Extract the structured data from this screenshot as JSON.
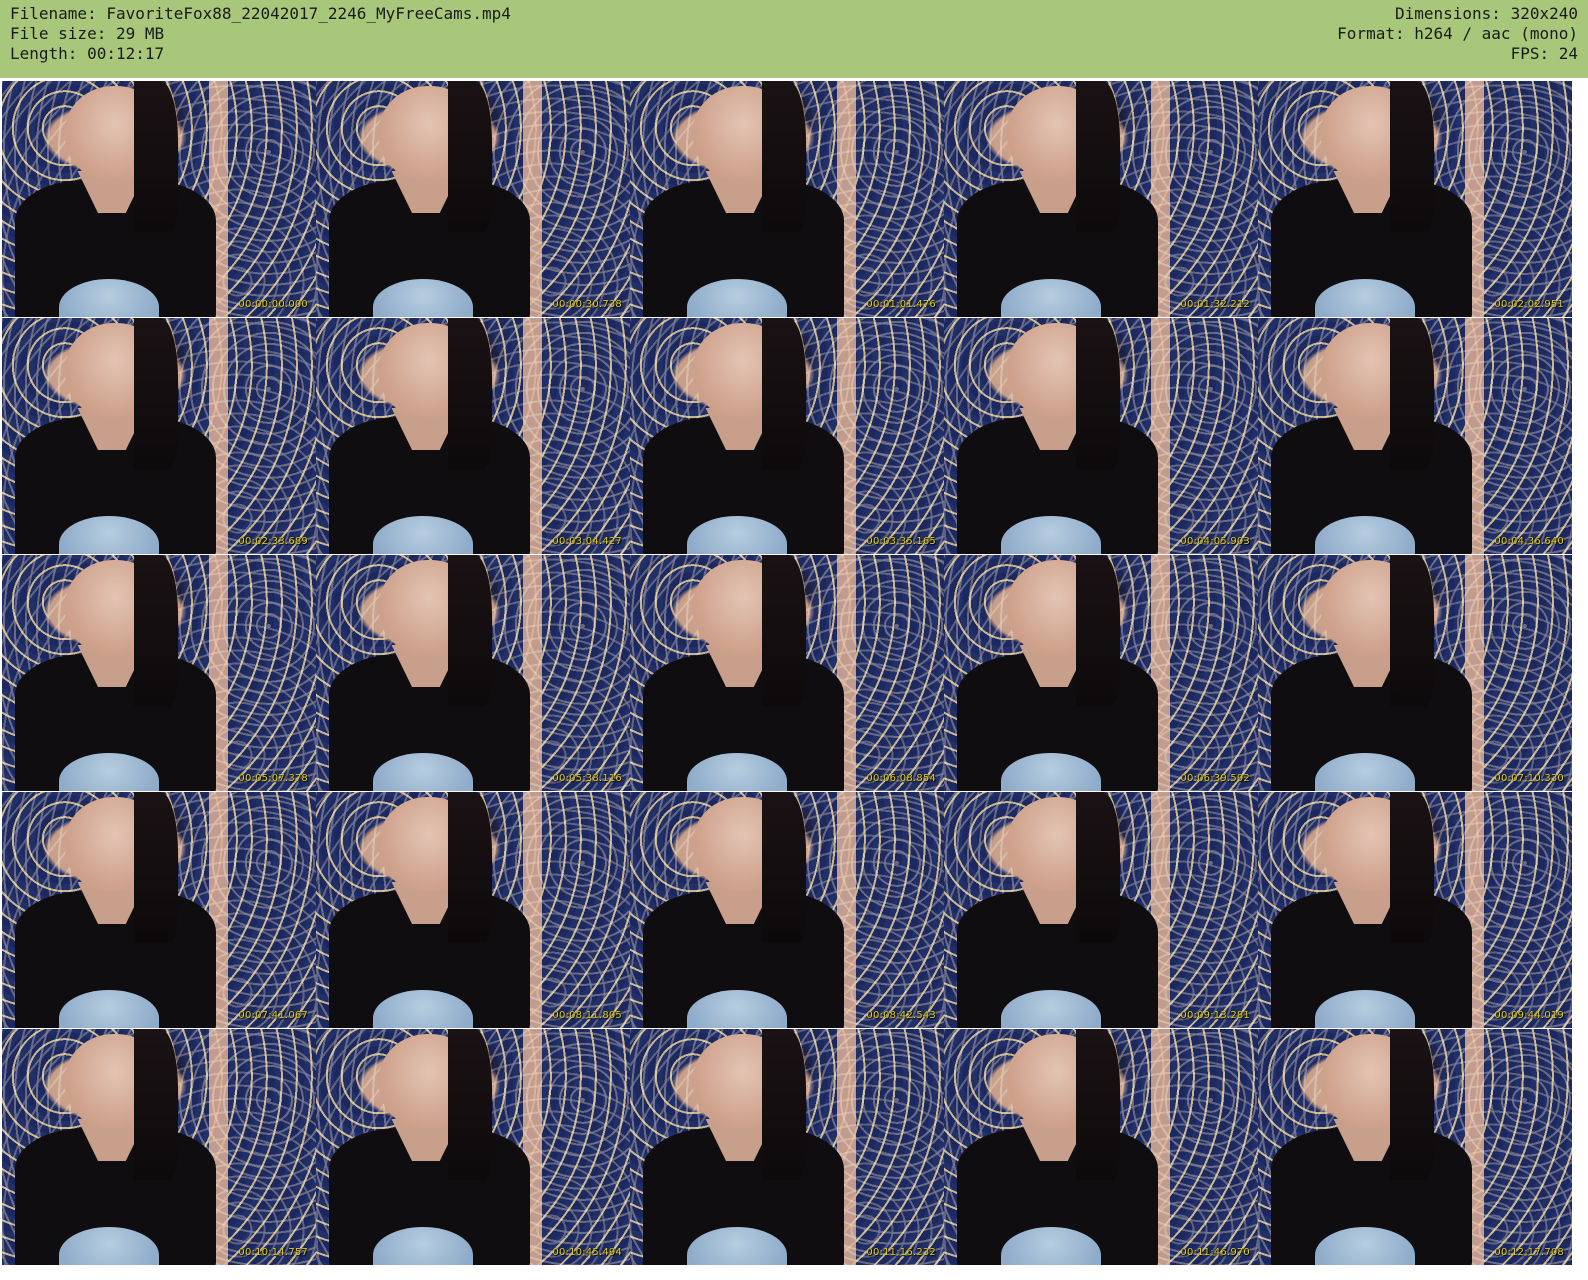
{
  "header": {
    "left": [
      "Filename: FavoriteFox88_22042017_2246_MyFreeCams.mp4",
      "File size: 29 MB",
      "Length: 00:12:17"
    ],
    "right": [
      "Dimensions: 320x240",
      "Format: h264 / aac (mono)",
      "FPS: 24"
    ]
  },
  "thumbnails": [
    {
      "timestamp": "00:00:00.000"
    },
    {
      "timestamp": "00:00:30.738"
    },
    {
      "timestamp": "00:01:01.476"
    },
    {
      "timestamp": "00:01:32.212"
    },
    {
      "timestamp": "00:02:02.951"
    },
    {
      "timestamp": "00:02:33.689"
    },
    {
      "timestamp": "00:03:04.427"
    },
    {
      "timestamp": "00:03:35.165"
    },
    {
      "timestamp": "00:04:05.903"
    },
    {
      "timestamp": "00:04:36.640"
    },
    {
      "timestamp": "00:05:07.378"
    },
    {
      "timestamp": "00:05:38.116"
    },
    {
      "timestamp": "00:06:08.854"
    },
    {
      "timestamp": "00:06:39.592"
    },
    {
      "timestamp": "00:07:10.330"
    },
    {
      "timestamp": "00:07:41.067"
    },
    {
      "timestamp": "00:08:11.805"
    },
    {
      "timestamp": "00:08:42.543"
    },
    {
      "timestamp": "00:09:13.281"
    },
    {
      "timestamp": "00:09:44.019"
    },
    {
      "timestamp": "00:10:14.757"
    },
    {
      "timestamp": "00:10:45.494"
    },
    {
      "timestamp": "00:11:16.232"
    },
    {
      "timestamp": "00:11:46.970"
    },
    {
      "timestamp": "00:12:17.708"
    }
  ]
}
